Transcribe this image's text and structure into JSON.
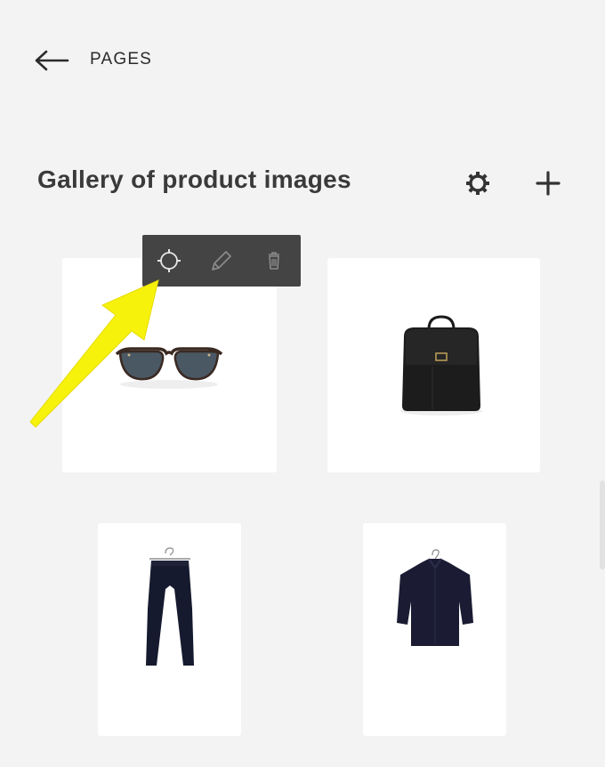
{
  "nav": {
    "back_label": "PAGES"
  },
  "gallery": {
    "title": "Gallery of product images",
    "items": [
      {
        "name": "sunglasses"
      },
      {
        "name": "black backpack"
      },
      {
        "name": "navy trousers"
      },
      {
        "name": "navy top"
      }
    ]
  },
  "toolbar": {
    "icons": [
      "settings-icon",
      "pencil-icon",
      "trash-icon"
    ]
  },
  "annotation": {
    "arrow_color": "#f7f20c"
  },
  "colors": {
    "background": "#f3f3f3",
    "toolbar": "#444444",
    "card": "#ffffff",
    "text": "#3a3a3a"
  }
}
